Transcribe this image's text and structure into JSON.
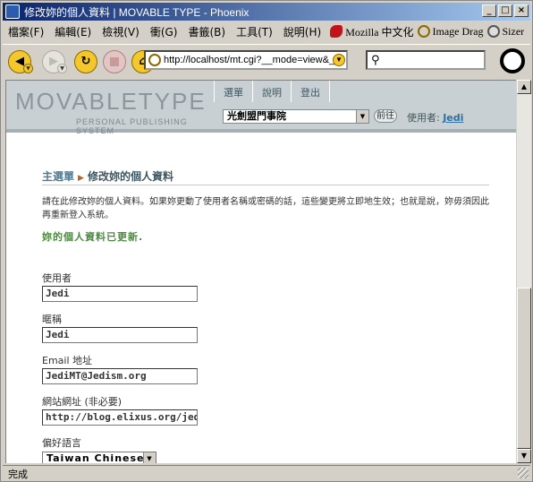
{
  "window": {
    "title": "修改妳的個人資料 | MOVABLE TYPE - Phoenix",
    "controls": {
      "minimize": "_",
      "maximize": "□",
      "close": "×"
    }
  },
  "menubar": {
    "items": [
      "檔案(F)",
      "編輯(E)",
      "檢視(V)",
      "衝(G)",
      "書籤(B)",
      "工具(T)",
      "說明(H)"
    ],
    "extensions": [
      {
        "label": "Mozilla 中文化",
        "icon": "mozilla-icon"
      },
      {
        "label": "Image Drag",
        "icon": "image-drag-icon"
      },
      {
        "label": "Sizer",
        "icon": "sizer-icon"
      }
    ]
  },
  "toolbar": {
    "url": "http://localhost/mt.cgi?__mode=view&_:",
    "search_value": ""
  },
  "mt": {
    "logo_text": "MOVABLETYPE",
    "logo_sub": "PERSONAL PUBLISHING SYSTEM",
    "nav": [
      "選單",
      "說明",
      "登出"
    ],
    "blog_selected": "光劍盟門事院",
    "go_label": "前往",
    "user_prefix": "使用者:",
    "user_name": "Jedi"
  },
  "page": {
    "breadcrumb_home": "主選單",
    "breadcrumb_current": "修改妳的個人資料",
    "intro": "請在此修改妳的個人資料。如果妳更動了使用者名稱或密碼的話，這些變更將立即地生效；也就是說，妳毋須因此再重新登入系統。",
    "success": "妳的個人資料已更新."
  },
  "form": {
    "username_label": "使用者",
    "username_value": "Jedi",
    "nickname_label": "暱稱",
    "nickname_value": "Jedi",
    "email_label": "Email 地址",
    "email_value": "JediMT@Jedism.org",
    "url_label": "網站網址 (非必要)",
    "url_value": "http://blog.elixus.org/jedi",
    "lang_label": "偏好語言",
    "lang_value": "Taiwan Chinese"
  },
  "status": {
    "text": "完成"
  },
  "colors": {
    "titlebar": "#0a246a",
    "mt_header": "#c8d0d3",
    "success": "#4b8a3e",
    "accent": "#4d7a8f"
  }
}
